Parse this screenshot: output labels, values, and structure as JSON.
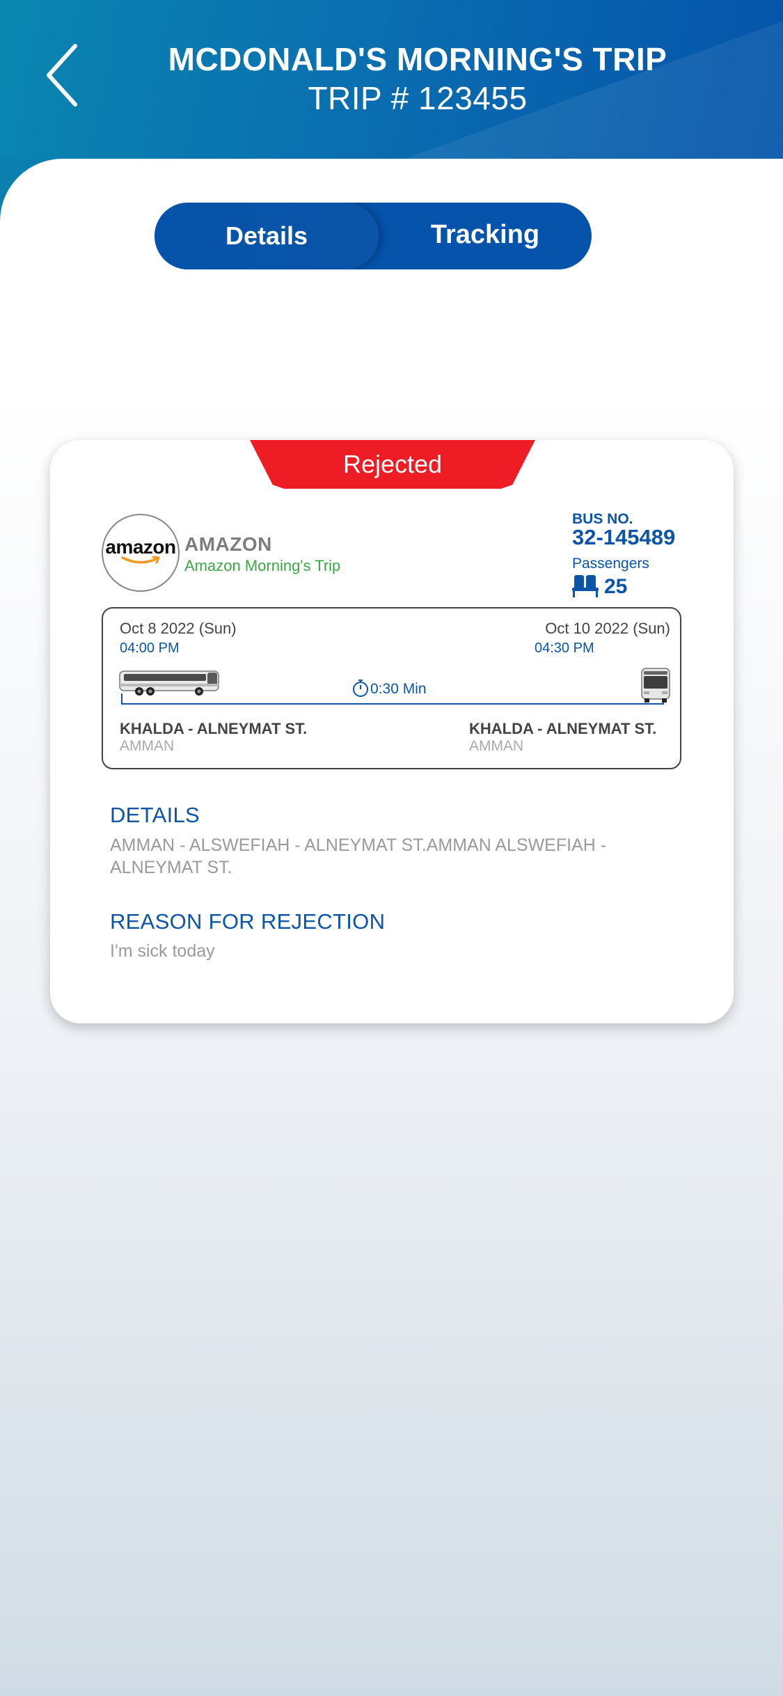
{
  "header": {
    "title": "MCDONALD'S MORNING'S TRIP",
    "subtitle": "TRIP # 123455"
  },
  "tabs": [
    {
      "label": "Details",
      "active": true
    },
    {
      "label": "Tracking",
      "active": false
    }
  ],
  "card": {
    "status": "Rejected",
    "status_color": "#ee1c25",
    "company": {
      "logo_text": "amazon",
      "name": "AMAZON",
      "trip_name": "Amazon Morning's Trip"
    },
    "bus": {
      "label": "BUS NO.",
      "number": "32-145489",
      "passengers_label": "Passengers",
      "passengers": "25"
    },
    "route": {
      "start_date": "Oct 8 2022 (Sun)",
      "start_time": "04:00 PM",
      "end_date": "Oct 10 2022 (Sun)",
      "end_time": "04:30 PM",
      "duration": "0:30 Min",
      "start_place": "KHALDA - ALNEYMAT ST.",
      "start_city": "AMMAN",
      "end_place": "KHALDA - ALNEYMAT ST.",
      "end_city": "AMMAN"
    },
    "details_title": "DETAILS",
    "details_text": "AMMAN - ALSWEFIAH - ALNEYMAT ST.AMMAN ALSWEFIAH - ALNEYMAT ST.",
    "reason_title": "REASON FOR REJECTION",
    "reason_text": "I'm sick today"
  },
  "colors": {
    "primary": "#0b54a8",
    "accent_green": "#3aa845",
    "rejected": "#ee1c25"
  }
}
